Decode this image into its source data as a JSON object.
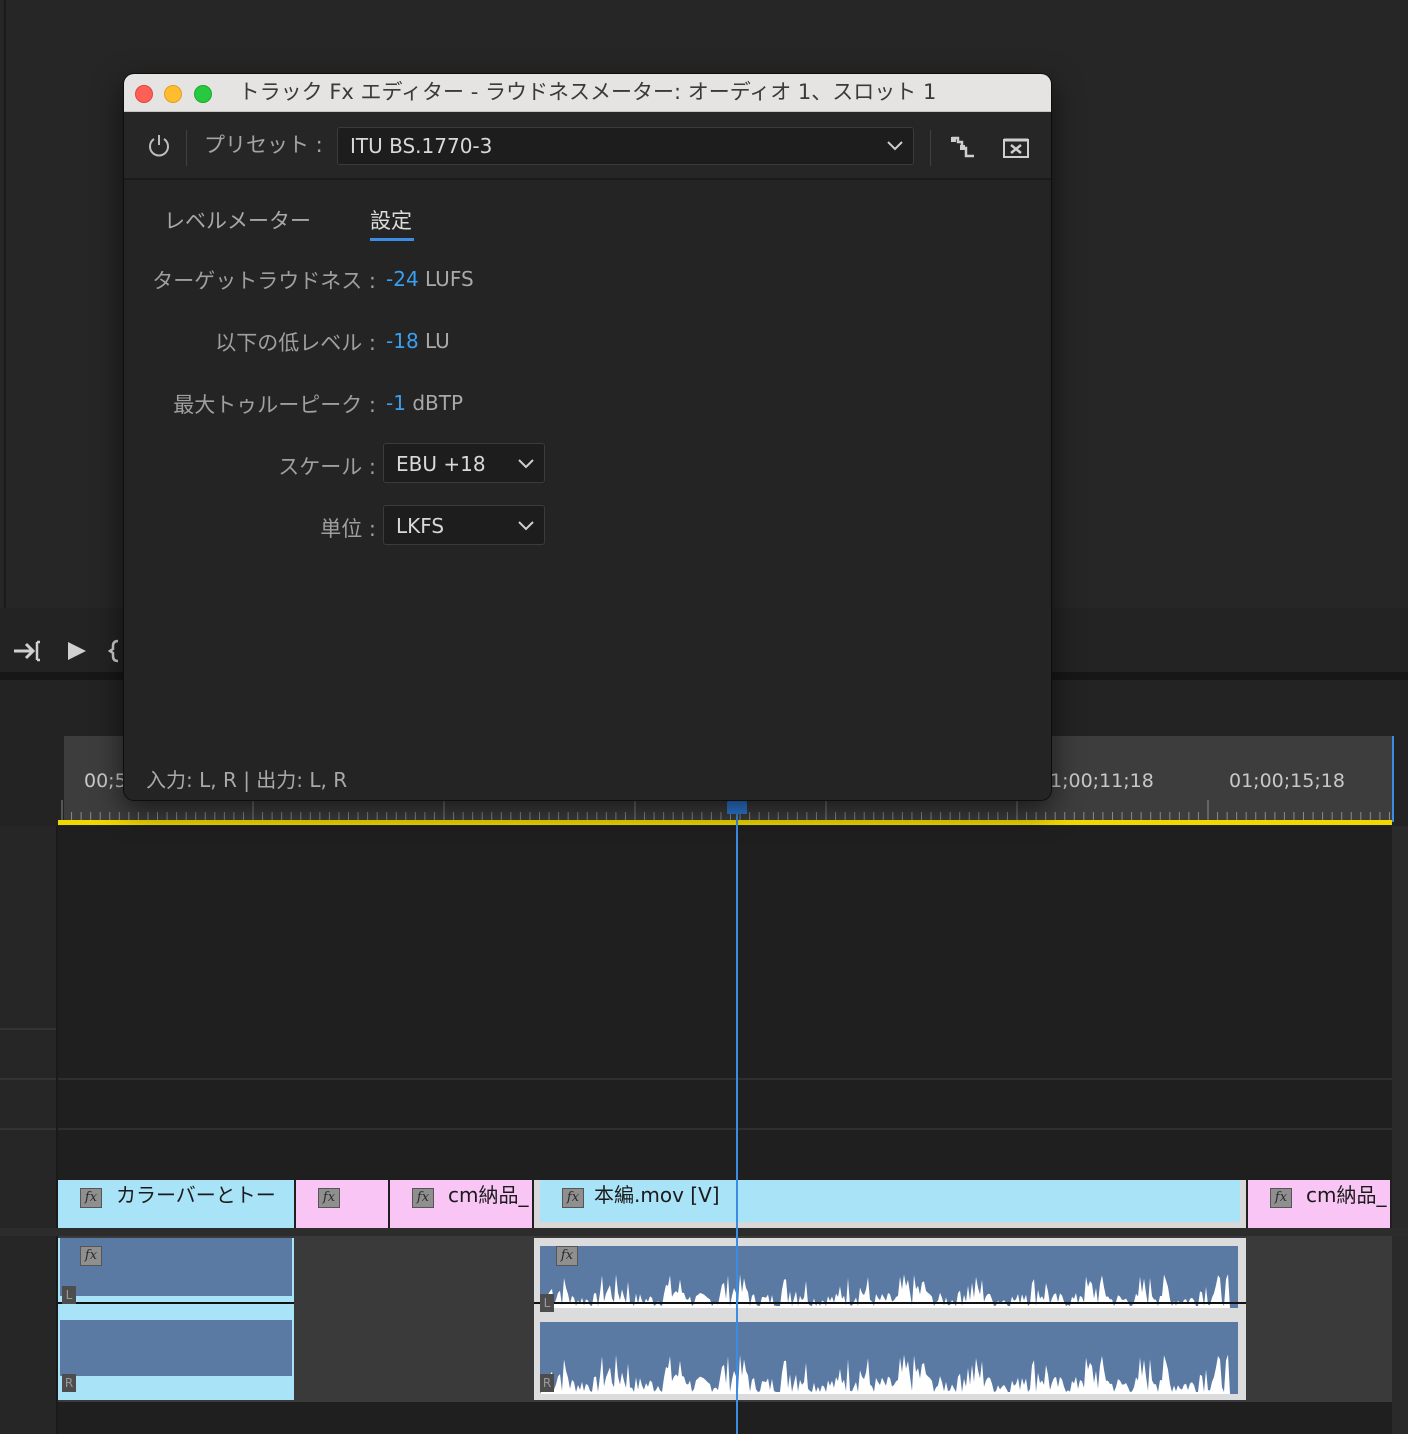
{
  "window": {
    "title": "トラック Fx エディター - ラウドネスメーター: オーディオ 1、スロット 1",
    "preset_label": "プリセット :",
    "preset_value": "ITU BS.1770-3",
    "tabs": [
      {
        "label": "レベルメーター",
        "active": false
      },
      {
        "label": "設定",
        "active": true
      }
    ],
    "fields": {
      "target_loudness": {
        "label": "ターゲットラウドネス :",
        "value": "-24",
        "unit": "LUFS"
      },
      "low_level": {
        "label": "以下の低レベル :",
        "value": "-18",
        "unit": "LU"
      },
      "max_true_peak": {
        "label": "最大トゥルーピーク :",
        "value": "-1",
        "unit": "dBTP"
      },
      "scale": {
        "label": "スケール :",
        "value": "EBU +18"
      },
      "units": {
        "label": "単位 :",
        "value": "LKFS"
      }
    },
    "io_text": "入力: L, R | 出力: L, R"
  },
  "timeline": {
    "timecodes": [
      "00;5",
      "1;00;11;18",
      "01;00;15;18"
    ],
    "video_clips": [
      {
        "label": "カラーバーとトー",
        "color": "#a9e3f7"
      },
      {
        "label": "",
        "color": "#f9c5f5"
      },
      {
        "label": "cm納品_",
        "color": "#f9c5f5"
      },
      {
        "label": "本編.mov [V]",
        "color": "#a9e3f7"
      },
      {
        "label": "cm納品_",
        "color": "#f9c5f5"
      }
    ],
    "fx_badge": "fx",
    "channel_left": "L",
    "channel_right": "R"
  },
  "colors": {
    "accent": "#3b8de3",
    "value_blue": "#3a9fef",
    "work_area": "#f0d800",
    "audio_clip": "#5a7aa3"
  }
}
